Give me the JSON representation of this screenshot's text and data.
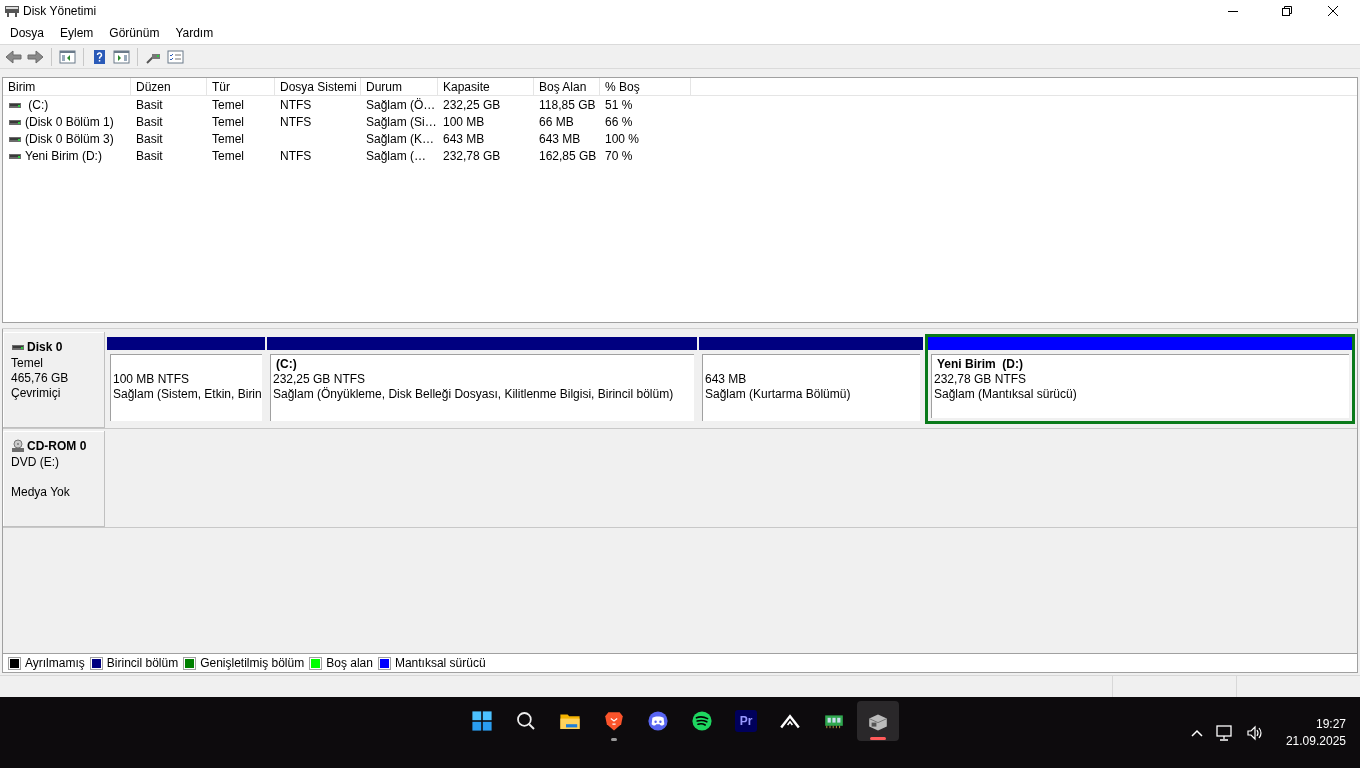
{
  "window": {
    "title": "Disk Yönetimi"
  },
  "menu": [
    "Dosya",
    "Eylem",
    "Görünüm",
    "Yardım"
  ],
  "toolbar": [
    {
      "kind": "back"
    },
    {
      "kind": "forward"
    },
    {
      "kind": "sep"
    },
    {
      "kind": "tree"
    },
    {
      "kind": "sep"
    },
    {
      "kind": "help"
    },
    {
      "kind": "pane"
    },
    {
      "kind": "sep"
    },
    {
      "kind": "connect"
    },
    {
      "kind": "props"
    }
  ],
  "table": {
    "columns": [
      "Birim",
      "Düzen",
      "Tür",
      "Dosya Sistemi",
      "Durum",
      "Kapasite",
      "Boş Alan",
      "% Boş"
    ],
    "rows": [
      {
        "cells": [
          " (C:)",
          "Basit",
          "Temel",
          "NTFS",
          "Sağlam (Ö…",
          "232,25 GB",
          "118,85 GB",
          "51 %"
        ]
      },
      {
        "cells": [
          "(Disk 0 Bölüm 1)",
          "Basit",
          "Temel",
          "NTFS",
          "Sağlam (Si…",
          "100 MB",
          "66 MB",
          "66 %"
        ]
      },
      {
        "cells": [
          "(Disk 0 Bölüm 3)",
          "Basit",
          "Temel",
          "",
          "Sağlam (K…",
          "643 MB",
          "643 MB",
          "100 %"
        ]
      },
      {
        "cells": [
          "Yeni Birim (D:)",
          "Basit",
          "Temel",
          "NTFS",
          "Sağlam (…",
          "232,78 GB",
          "162,85 GB",
          "70 %"
        ]
      }
    ]
  },
  "disks": [
    {
      "kind": "disk",
      "name": "Disk 0",
      "lines": [
        "Temel",
        "465,76 GB",
        "Çevrimiçi"
      ],
      "partitions": [
        {
          "color": "#000080",
          "selected": false,
          "size": "100 MB NTFS",
          "status": "Sağlam (Sistem, Etkin, Birin"
        },
        {
          "color": "#000080",
          "selected": false,
          "name": "(C:)",
          "size": "232,25 GB NTFS",
          "status": "Sağlam (Önyükleme, Disk Belleği Dosyası, Kilitlenme Bilgisi, Birincil bölüm)"
        },
        {
          "color": "#000080",
          "selected": false,
          "size": "643 MB",
          "status": "Sağlam (Kurtarma Bölümü)"
        },
        {
          "color": "#0000ff",
          "selected": true,
          "name": "Yeni Birim  (D:)",
          "size": "232,78 GB NTFS",
          "status": "Sağlam (Mantıksal sürücü)"
        }
      ]
    },
    {
      "kind": "cdrom",
      "name": "CD-ROM 0",
      "lines": [
        "DVD (E:)",
        "Medya Yok"
      ]
    }
  ],
  "legend": [
    {
      "label": "Ayrılmamış",
      "color": "#000000"
    },
    {
      "label": "Birincil bölüm",
      "color": "#000080"
    },
    {
      "label": "Genişletilmiş bölüm",
      "color": "#008000"
    },
    {
      "label": "Boş alan",
      "color": "#00ff00"
    },
    {
      "label": "Mantıksal sürücü",
      "color": "#0000ff"
    }
  ],
  "taskbar": {
    "apps": [
      {
        "kind": "start",
        "running": false,
        "selected": false
      },
      {
        "kind": "search",
        "running": false,
        "selected": false
      },
      {
        "kind": "folder",
        "running": false,
        "selected": false
      },
      {
        "kind": "lion",
        "running": true,
        "selected": false
      },
      {
        "kind": "chat",
        "running": false,
        "selected": false
      },
      {
        "kind": "music",
        "running": false,
        "selected": false
      },
      {
        "kind": "video",
        "label": "Pr",
        "running": false,
        "selected": false
      },
      {
        "kind": "peak",
        "running": false,
        "selected": false
      },
      {
        "kind": "chip",
        "running": false,
        "selected": false
      },
      {
        "kind": "diskmgmt",
        "running": true,
        "selected": true
      }
    ],
    "time": "19:27",
    "date": "21.09.2025"
  }
}
